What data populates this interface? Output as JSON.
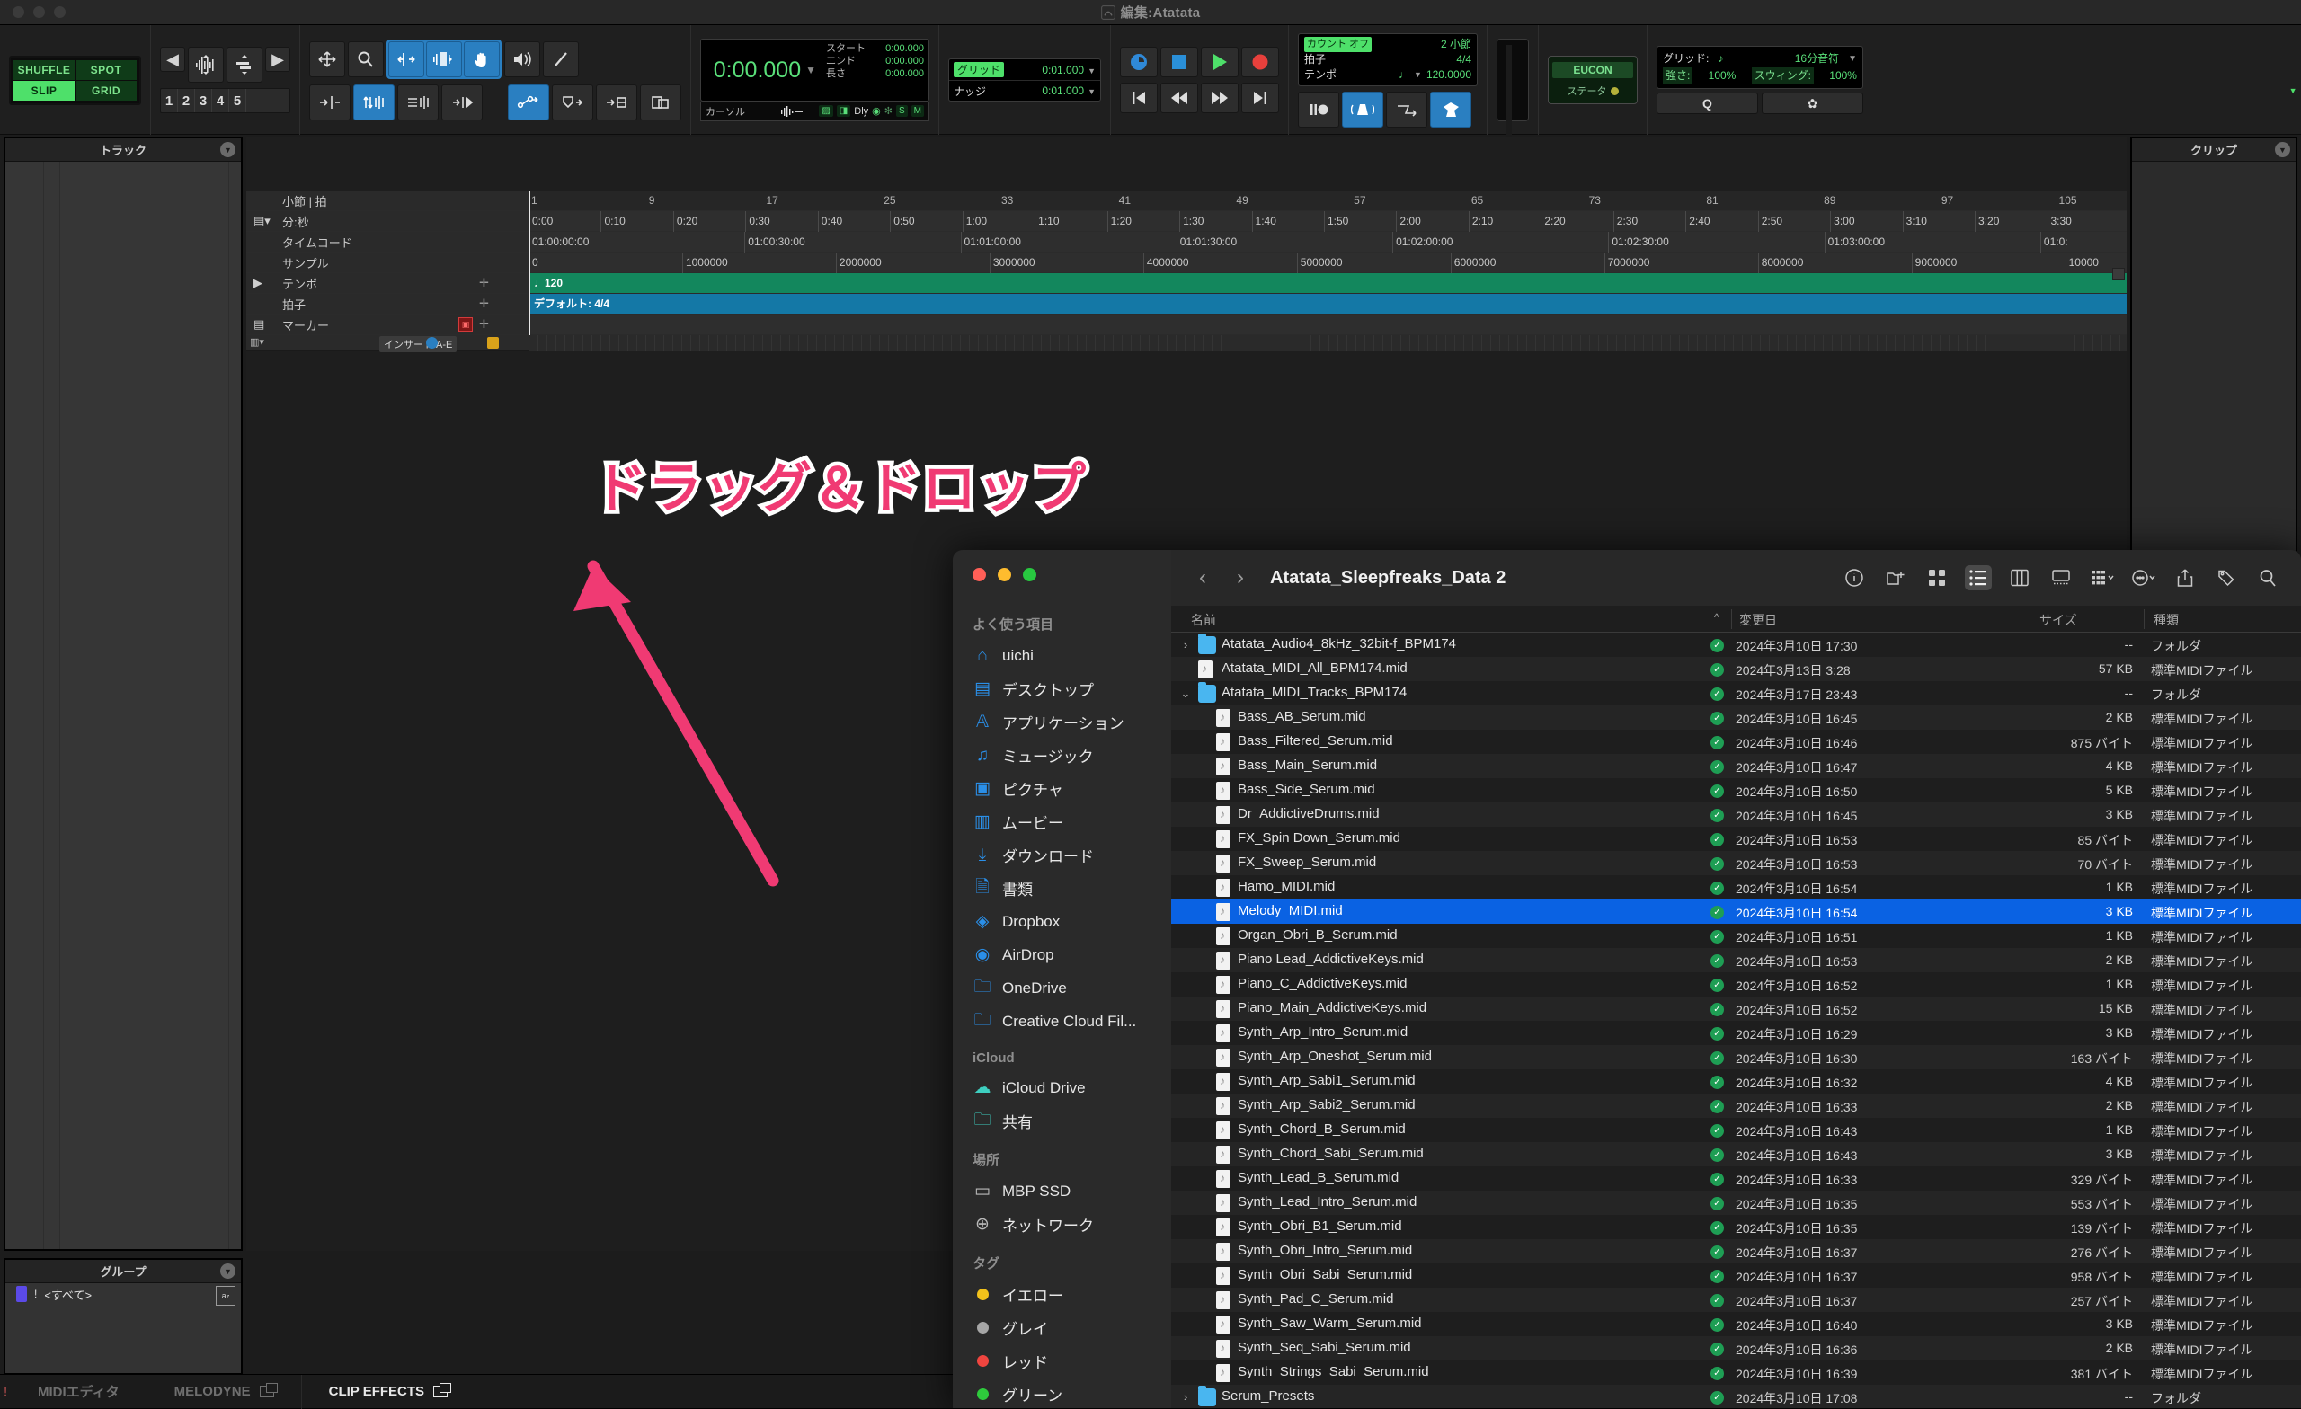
{
  "window": {
    "title": "編集:Atatata"
  },
  "annotation": {
    "text": "ドラッグ＆ドロップ",
    "color": "#f03a73"
  },
  "toolbar": {
    "modes": {
      "shuffle": "SHUFFLE",
      "spot": "SPOT",
      "slip": "SLIP",
      "grid": "GRID",
      "active": "SLIP"
    },
    "memory_numbers": [
      "1",
      "2",
      "3",
      "4",
      "5"
    ],
    "counter": {
      "main_time": "0:00.000",
      "rows": [
        {
          "label": "スタート",
          "value": "0:00.000"
        },
        {
          "label": "エンド",
          "value": "0:00.000"
        },
        {
          "label": "長さ",
          "value": "0:00.000"
        }
      ],
      "cursor_label": "カーソル",
      "badges": [
        "Dly",
        "S",
        "M"
      ]
    },
    "gridnudge": [
      {
        "label": "グリッド",
        "value": "0:01.000"
      },
      {
        "label": "ナッジ",
        "value": "0:01.000"
      }
    ],
    "tempo": {
      "count_off_label": "カウント オフ",
      "count_off_value": "2 小節",
      "meter_label": "拍子",
      "meter_value": "4/4",
      "tempo_label": "テンポ",
      "tempo_value": "120.0000"
    },
    "eucon": {
      "label": "EUCON",
      "status_label": "ステータ"
    },
    "quantize": {
      "grid_label": "グリッド:",
      "grid_value": "16分音符",
      "strength_label": "強さ:",
      "strength_value": "100%",
      "swing_label": "スウィング:",
      "swing_value": "100%"
    }
  },
  "panels": {
    "tracks_title": "トラック",
    "clips_title": "クリップ",
    "groups_title": "グループ",
    "groups_rows": [
      {
        "name": "<すべて>"
      }
    ]
  },
  "ruler": {
    "rows": [
      {
        "label": "小節 | 拍"
      },
      {
        "label": "分:秒"
      },
      {
        "label": "タイムコード"
      },
      {
        "label": "サンプル"
      },
      {
        "label": "テンポ"
      },
      {
        "label": "拍子"
      },
      {
        "label": "マーカー"
      }
    ],
    "bars": [
      "1",
      "9",
      "17",
      "25",
      "33",
      "41",
      "49",
      "57",
      "65",
      "73",
      "81",
      "89",
      "97",
      "105"
    ],
    "minsec": [
      "0:00",
      "0:10",
      "0:20",
      "0:30",
      "0:40",
      "0:50",
      "1:00",
      "1:10",
      "1:20",
      "1:30",
      "1:40",
      "1:50",
      "2:00",
      "2:10",
      "2:20",
      "2:30",
      "2:40",
      "2:50",
      "3:00",
      "3:10",
      "3:20",
      "3:30"
    ],
    "timecode": [
      "01:00:00:00",
      "01:00:30:00",
      "01:01:00:00",
      "01:01:30:00",
      "01:02:00:00",
      "01:02:30:00",
      "01:03:00:00",
      "01:0:"
    ],
    "samples": [
      "0",
      "1000000",
      "2000000",
      "3000000",
      "4000000",
      "5000000",
      "6000000",
      "7000000",
      "8000000",
      "9000000",
      "10000"
    ],
    "tempo_value": "120",
    "meter_value": "デフォルト: 4/4",
    "track_insert_label": "インサート A-E"
  },
  "bottom_tabs": [
    {
      "label": "MIDIエディタ",
      "active": false,
      "has_icon": false
    },
    {
      "label": "MELODYNE",
      "active": false,
      "has_icon": true
    },
    {
      "label": "CLIP EFFECTS",
      "active": true,
      "has_icon": true
    }
  ],
  "finder": {
    "title": "Atatata_Sleepfreaks_Data 2",
    "sidebar": [
      {
        "group": "よく使う項目",
        "items": [
          {
            "label": "uichi",
            "icon": "home-icon"
          },
          {
            "label": "デスクトップ",
            "icon": "desktop-icon"
          },
          {
            "label": "アプリケーション",
            "icon": "applications-icon"
          },
          {
            "label": "ミュージック",
            "icon": "music-icon"
          },
          {
            "label": "ピクチャ",
            "icon": "pictures-icon"
          },
          {
            "label": "ムービー",
            "icon": "movies-icon"
          },
          {
            "label": "ダウンロード",
            "icon": "downloads-icon"
          },
          {
            "label": "書類",
            "icon": "documents-icon"
          },
          {
            "label": "Dropbox",
            "icon": "dropbox-icon"
          },
          {
            "label": "AirDrop",
            "icon": "airdrop-icon"
          },
          {
            "label": "OneDrive",
            "icon": "folder-icon"
          },
          {
            "label": "Creative Cloud Fil...",
            "icon": "folder-icon"
          }
        ]
      },
      {
        "group": "iCloud",
        "items": [
          {
            "label": "iCloud Drive",
            "icon": "cloud-icon"
          },
          {
            "label": "共有",
            "icon": "shared-folder-icon"
          }
        ]
      },
      {
        "group": "場所",
        "items": [
          {
            "label": "MBP SSD",
            "icon": "drive-icon"
          },
          {
            "label": "ネットワーク",
            "icon": "network-icon"
          }
        ]
      },
      {
        "group": "タグ",
        "items": [
          {
            "label": "イエロー",
            "icon": "tag-dot-icon",
            "color": "#f2c21b"
          },
          {
            "label": "グレイ",
            "icon": "tag-dot-icon",
            "color": "#a6a6a6"
          },
          {
            "label": "レッド",
            "icon": "tag-dot-icon",
            "color": "#f0453f"
          },
          {
            "label": "グリーン",
            "icon": "tag-dot-icon",
            "color": "#2ecb3c"
          }
        ]
      }
    ],
    "columns": {
      "name": "名前",
      "date": "変更日",
      "size": "サイズ",
      "kind": "種類",
      "sort_caret": "^"
    },
    "rows": [
      {
        "name": "Atatata_Audio4_8kHz_32bit-f_BPM174",
        "date": "2024年3月10日 17:30",
        "size": "--",
        "kind": "フォルダ",
        "type": "folder",
        "indent": 0,
        "disc": "›",
        "selected": false
      },
      {
        "name": "Atatata_MIDI_All_BPM174.mid",
        "date": "2024年3月13日 3:28",
        "size": "57 KB",
        "kind": "標準MIDIファイル",
        "type": "mid",
        "indent": 0,
        "disc": "",
        "selected": false
      },
      {
        "name": "Atatata_MIDI_Tracks_BPM174",
        "date": "2024年3月17日 23:43",
        "size": "--",
        "kind": "フォルダ",
        "type": "folder",
        "indent": 0,
        "disc": "⌄",
        "selected": false
      },
      {
        "name": "Bass_AB_Serum.mid",
        "date": "2024年3月10日 16:45",
        "size": "2 KB",
        "kind": "標準MIDIファイル",
        "type": "mid",
        "indent": 1,
        "disc": "",
        "selected": false
      },
      {
        "name": "Bass_Filtered_Serum.mid",
        "date": "2024年3月10日 16:46",
        "size": "875 バイト",
        "kind": "標準MIDIファイル",
        "type": "mid",
        "indent": 1,
        "disc": "",
        "selected": false
      },
      {
        "name": "Bass_Main_Serum.mid",
        "date": "2024年3月10日 16:47",
        "size": "4 KB",
        "kind": "標準MIDIファイル",
        "type": "mid",
        "indent": 1,
        "disc": "",
        "selected": false
      },
      {
        "name": "Bass_Side_Serum.mid",
        "date": "2024年3月10日 16:50",
        "size": "5 KB",
        "kind": "標準MIDIファイル",
        "type": "mid",
        "indent": 1,
        "disc": "",
        "selected": false
      },
      {
        "name": "Dr_AddictiveDrums.mid",
        "date": "2024年3月10日 16:45",
        "size": "3 KB",
        "kind": "標準MIDIファイル",
        "type": "mid",
        "indent": 1,
        "disc": "",
        "selected": false
      },
      {
        "name": "FX_Spin Down_Serum.mid",
        "date": "2024年3月10日 16:53",
        "size": "85 バイト",
        "kind": "標準MIDIファイル",
        "type": "mid",
        "indent": 1,
        "disc": "",
        "selected": false
      },
      {
        "name": "FX_Sweep_Serum.mid",
        "date": "2024年3月10日 16:53",
        "size": "70 バイト",
        "kind": "標準MIDIファイル",
        "type": "mid",
        "indent": 1,
        "disc": "",
        "selected": false
      },
      {
        "name": "Hamo_MIDI.mid",
        "date": "2024年3月10日 16:54",
        "size": "1 KB",
        "kind": "標準MIDIファイル",
        "type": "mid",
        "indent": 1,
        "disc": "",
        "selected": false
      },
      {
        "name": "Melody_MIDI.mid",
        "date": "2024年3月10日 16:54",
        "size": "3 KB",
        "kind": "標準MIDIファイル",
        "type": "mid",
        "indent": 1,
        "disc": "",
        "selected": true
      },
      {
        "name": "Organ_Obri_B_Serum.mid",
        "date": "2024年3月10日 16:51",
        "size": "1 KB",
        "kind": "標準MIDIファイル",
        "type": "mid",
        "indent": 1,
        "disc": "",
        "selected": false
      },
      {
        "name": "Piano Lead_AddictiveKeys.mid",
        "date": "2024年3月10日 16:53",
        "size": "2 KB",
        "kind": "標準MIDIファイル",
        "type": "mid",
        "indent": 1,
        "disc": "",
        "selected": false
      },
      {
        "name": "Piano_C_AddictiveKeys.mid",
        "date": "2024年3月10日 16:52",
        "size": "1 KB",
        "kind": "標準MIDIファイル",
        "type": "mid",
        "indent": 1,
        "disc": "",
        "selected": false
      },
      {
        "name": "Piano_Main_AddictiveKeys.mid",
        "date": "2024年3月10日 16:52",
        "size": "15 KB",
        "kind": "標準MIDIファイル",
        "type": "mid",
        "indent": 1,
        "disc": "",
        "selected": false
      },
      {
        "name": "Synth_Arp_Intro_Serum.mid",
        "date": "2024年3月10日 16:29",
        "size": "3 KB",
        "kind": "標準MIDIファイル",
        "type": "mid",
        "indent": 1,
        "disc": "",
        "selected": false
      },
      {
        "name": "Synth_Arp_Oneshot_Serum.mid",
        "date": "2024年3月10日 16:30",
        "size": "163 バイト",
        "kind": "標準MIDIファイル",
        "type": "mid",
        "indent": 1,
        "disc": "",
        "selected": false
      },
      {
        "name": "Synth_Arp_Sabi1_Serum.mid",
        "date": "2024年3月10日 16:32",
        "size": "4 KB",
        "kind": "標準MIDIファイル",
        "type": "mid",
        "indent": 1,
        "disc": "",
        "selected": false
      },
      {
        "name": "Synth_Arp_Sabi2_Serum.mid",
        "date": "2024年3月10日 16:33",
        "size": "2 KB",
        "kind": "標準MIDIファイル",
        "type": "mid",
        "indent": 1,
        "disc": "",
        "selected": false
      },
      {
        "name": "Synth_Chord_B_Serum.mid",
        "date": "2024年3月10日 16:43",
        "size": "1 KB",
        "kind": "標準MIDIファイル",
        "type": "mid",
        "indent": 1,
        "disc": "",
        "selected": false
      },
      {
        "name": "Synth_Chord_Sabi_Serum.mid",
        "date": "2024年3月10日 16:43",
        "size": "3 KB",
        "kind": "標準MIDIファイル",
        "type": "mid",
        "indent": 1,
        "disc": "",
        "selected": false
      },
      {
        "name": "Synth_Lead_B_Serum.mid",
        "date": "2024年3月10日 16:33",
        "size": "329 バイト",
        "kind": "標準MIDIファイル",
        "type": "mid",
        "indent": 1,
        "disc": "",
        "selected": false
      },
      {
        "name": "Synth_Lead_Intro_Serum.mid",
        "date": "2024年3月10日 16:35",
        "size": "553 バイト",
        "kind": "標準MIDIファイル",
        "type": "mid",
        "indent": 1,
        "disc": "",
        "selected": false
      },
      {
        "name": "Synth_Obri_B1_Serum.mid",
        "date": "2024年3月10日 16:35",
        "size": "139 バイト",
        "kind": "標準MIDIファイル",
        "type": "mid",
        "indent": 1,
        "disc": "",
        "selected": false
      },
      {
        "name": "Synth_Obri_Intro_Serum.mid",
        "date": "2024年3月10日 16:37",
        "size": "276 バイト",
        "kind": "標準MIDIファイル",
        "type": "mid",
        "indent": 1,
        "disc": "",
        "selected": false
      },
      {
        "name": "Synth_Obri_Sabi_Serum.mid",
        "date": "2024年3月10日 16:37",
        "size": "958 バイト",
        "kind": "標準MIDIファイル",
        "type": "mid",
        "indent": 1,
        "disc": "",
        "selected": false
      },
      {
        "name": "Synth_Pad_C_Serum.mid",
        "date": "2024年3月10日 16:37",
        "size": "257 バイト",
        "kind": "標準MIDIファイル",
        "type": "mid",
        "indent": 1,
        "disc": "",
        "selected": false
      },
      {
        "name": "Synth_Saw_Warm_Serum.mid",
        "date": "2024年3月10日 16:40",
        "size": "3 KB",
        "kind": "標準MIDIファイル",
        "type": "mid",
        "indent": 1,
        "disc": "",
        "selected": false
      },
      {
        "name": "Synth_Seq_Sabi_Serum.mid",
        "date": "2024年3月10日 16:36",
        "size": "2 KB",
        "kind": "標準MIDIファイル",
        "type": "mid",
        "indent": 1,
        "disc": "",
        "selected": false
      },
      {
        "name": "Synth_Strings_Sabi_Serum.mid",
        "date": "2024年3月10日 16:39",
        "size": "381 バイト",
        "kind": "標準MIDIファイル",
        "type": "mid",
        "indent": 1,
        "disc": "",
        "selected": false
      },
      {
        "name": "Serum_Presets",
        "date": "2024年3月10日 17:08",
        "size": "--",
        "kind": "フォルダ",
        "type": "folder",
        "indent": 0,
        "disc": "›",
        "selected": false
      }
    ]
  }
}
